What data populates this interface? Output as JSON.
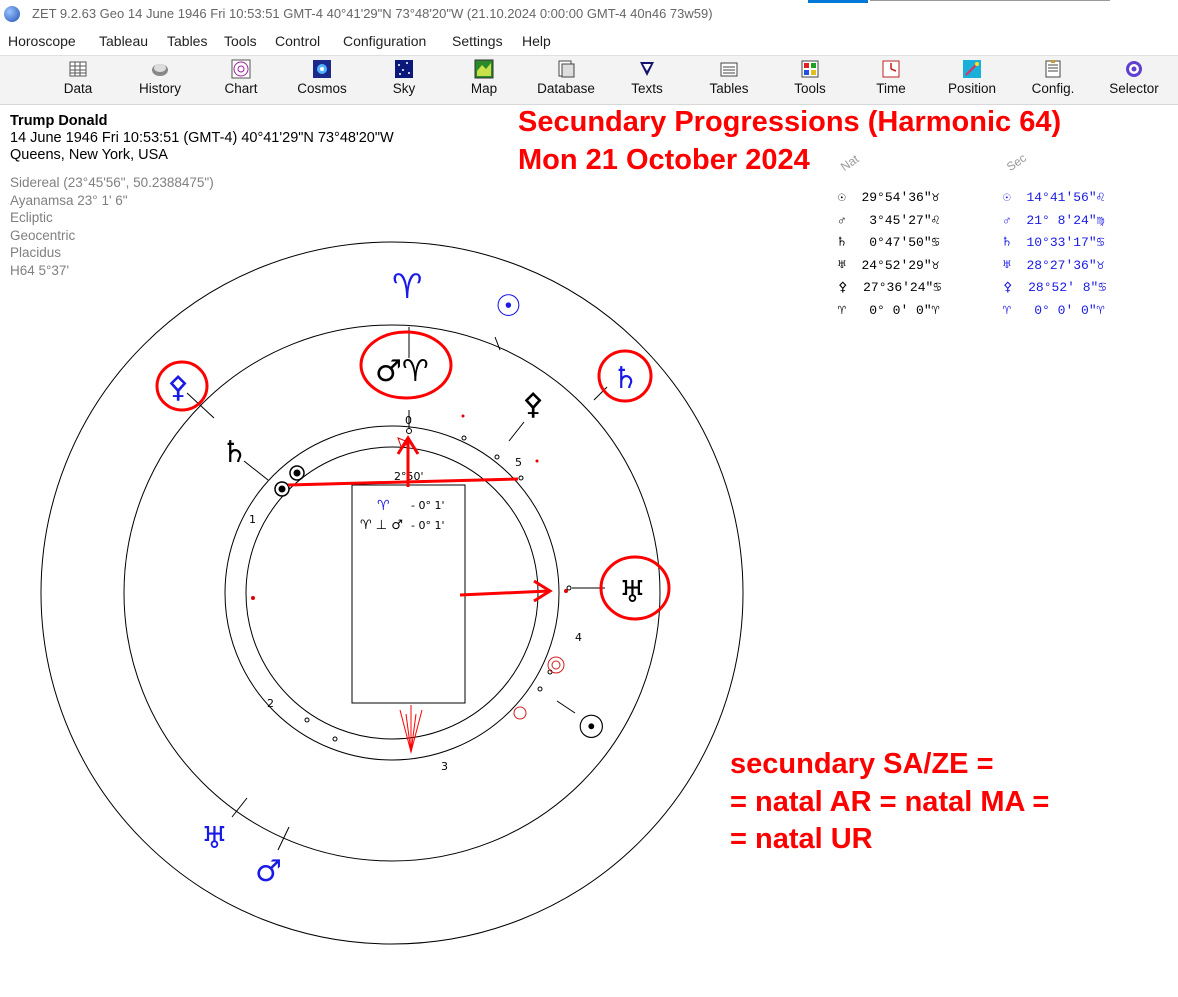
{
  "window": {
    "title": "ZET 9.2.63 Geo   14 June 1946  Fri  10:53:51 GMT-4 40°41'29\"N  73°48'20\"W   (21.10.2024   0:00:00 GMT-4 40n46 73w59)"
  },
  "menu": [
    "Horoscope",
    "Tableau",
    "Tables",
    "Tools",
    "Control",
    "Configuration",
    "Settings",
    "Help"
  ],
  "toolbar": [
    "Data",
    "History",
    "Chart",
    "Cosmos",
    "Sky",
    "Map",
    "Database",
    "Texts",
    "Tables",
    "Tools",
    "Time",
    "Position",
    "Config.",
    "Selector"
  ],
  "info": {
    "name": "Trump Donald",
    "datetime": "14 June 1946  Fri  10:53:51 (GMT-4) 40°41'29\"N  73°48'20\"W",
    "place": "Queens, New York, USA",
    "settings": [
      "Sidereal (23°45'56\", 50.2388475\")",
      "Ayanamsa 23° 1' 6\"",
      "Ecliptic",
      "Geocentric",
      "Placidus",
      "H64   5°37'"
    ]
  },
  "annotation": {
    "title1": "Secundary Progressions (Harmonic 64)",
    "title2": "Mon 21 October 2024",
    "note1": "secundary SA/ZE =",
    "note2": "= natal AR = natal MA =",
    "note3": "= natal UR"
  },
  "table": {
    "nat_header": "Nat",
    "sec_header": "Sec",
    "nat_rows": [
      {
        "glyph": "☉",
        "pos": "29°54'36\"",
        "sign": "♉"
      },
      {
        "glyph": "♂",
        "pos": " 3°45'27\"",
        "sign": "♌"
      },
      {
        "glyph": "♄",
        "pos": " 0°47'50\"",
        "sign": "♋"
      },
      {
        "glyph": "♅",
        "pos": "24°52'29\"",
        "sign": "♉"
      },
      {
        "glyph": "⚴",
        "pos": "27°36'24\"",
        "sign": "♋"
      },
      {
        "glyph": "♈",
        "pos": " 0° 0' 0\"",
        "sign": "♈"
      }
    ],
    "sec_rows": [
      {
        "glyph": "☉",
        "pos": "14°41'56\"",
        "sign": "♌"
      },
      {
        "glyph": "♂",
        "pos": "21° 8'24\"",
        "sign": "♍"
      },
      {
        "glyph": "♄",
        "pos": "10°33'17\"",
        "sign": "♋"
      },
      {
        "glyph": "♅",
        "pos": "28°27'36\"",
        "sign": "♉"
      },
      {
        "glyph": "⚴",
        "pos": "28°52' 8\"",
        "sign": "♋"
      },
      {
        "glyph": "♈",
        "pos": " 0° 0' 0\"",
        "sign": "♈"
      }
    ]
  },
  "chart": {
    "center_degree": "2°50'",
    "aspect_line1": {
      "glyph": "♈",
      "value": "- 0° 1'"
    },
    "aspect_line2": {
      "glyph": "♈ ⊥ ♂",
      "value": "- 0° 1'"
    },
    "house_labels": [
      "0",
      "1",
      "2",
      "3",
      "4",
      "5"
    ],
    "outer_glyphs": {
      "aries_top": "♈",
      "sun_outer": "☉",
      "saturn_outer": "♄",
      "sa_ze_outer": "⚴",
      "uranus_outer": "♅",
      "mars_outer": "♂"
    },
    "inner_glyphs": {
      "mars_aries": "♂♈",
      "saturn_inner": "♄",
      "sa_ze_inner": "⚴",
      "uranus_inner": "♅",
      "sun_inner": "☉"
    },
    "colors": {
      "natal": "#000000",
      "secundary": "#1a1ae6",
      "highlight": "#ff0000"
    }
  }
}
